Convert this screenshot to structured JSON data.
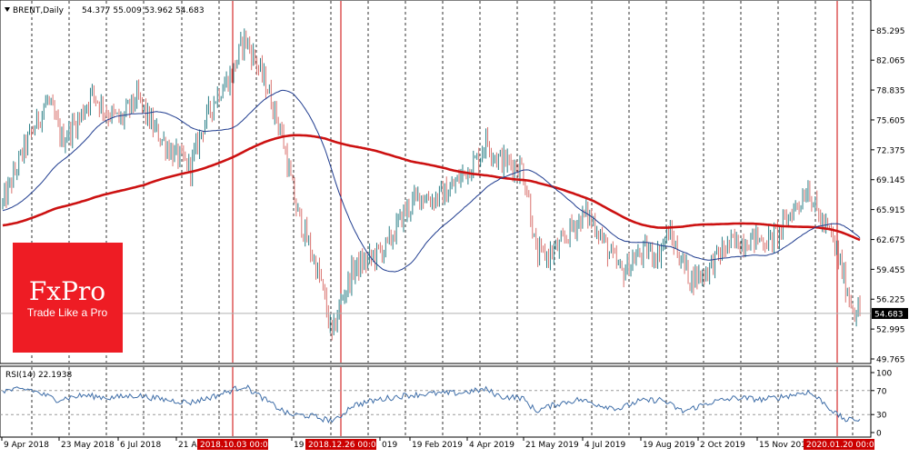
{
  "header": {
    "symbol_label": "BRENT,Daily",
    "ohlc": "54.377 55.009 53.962 54.683"
  },
  "logo": {
    "brand": "FxPro",
    "tagline": "Trade Like a Pro"
  },
  "rsi_label": "RSI(14) 22.1938",
  "colors": {
    "bull": "#2a7f86",
    "bear": "#d9736f",
    "ma_slow": "#cc1111",
    "ma_fast": "#1f3c8f",
    "marker": "#cc0000",
    "logo_bg": "#ee1c24",
    "rsi_line": "#3f6ea8",
    "current_bg": "#000000"
  },
  "chart_data": {
    "type": "candlestick",
    "symbol": "BRENT",
    "timeframe": "Daily",
    "ylim": [
      49.765,
      86.8
    ],
    "price_ticks": [
      "85.295",
      "82.065",
      "78.835",
      "75.605",
      "72.375",
      "69.145",
      "65.915",
      "62.675",
      "59.455",
      "56.225",
      "52.995",
      "49.765"
    ],
    "current_price": "54.683",
    "x_ticks": [
      "9 Apr 2018",
      "23 May 2018",
      "6 Jul 2018",
      "21 Au",
      "19",
      "019",
      "19 Feb 2019",
      "4 Apr 2019",
      "21 May 2019",
      "4 Jul 2019",
      "19 Aug 2019",
      "2 Oct 2019",
      "15 Nov 201"
    ],
    "vertical_markers": [
      "2018.10.03 00:00",
      "2018.12.26 00:00",
      "2020.01.20 00:00"
    ],
    "price_keypoints": [
      [
        0,
        66.5
      ],
      [
        12,
        72.5
      ],
      [
        25,
        77.8
      ],
      [
        33,
        73.5
      ],
      [
        42,
        75.5
      ],
      [
        50,
        78.5
      ],
      [
        58,
        76.5
      ],
      [
        66,
        75.5
      ],
      [
        75,
        78.0
      ],
      [
        85,
        74.5
      ],
      [
        95,
        72.0
      ],
      [
        105,
        70.5
      ],
      [
        112,
        75.0
      ],
      [
        120,
        78.5
      ],
      [
        128,
        80.5
      ],
      [
        135,
        84.5
      ],
      [
        140,
        82.5
      ],
      [
        148,
        79.0
      ],
      [
        156,
        74.0
      ],
      [
        164,
        66.0
      ],
      [
        172,
        61.5
      ],
      [
        178,
        58.0
      ],
      [
        184,
        52.0
      ],
      [
        188,
        55.5
      ],
      [
        196,
        59.5
      ],
      [
        205,
        60.5
      ],
      [
        215,
        62.0
      ],
      [
        224,
        65.5
      ],
      [
        233,
        67.5
      ],
      [
        240,
        67.0
      ],
      [
        250,
        68.0
      ],
      [
        258,
        70.0
      ],
      [
        266,
        71.5
      ],
      [
        270,
        73.5
      ],
      [
        276,
        71.5
      ],
      [
        282,
        71.0
      ],
      [
        290,
        70.5
      ],
      [
        294,
        67.0
      ],
      [
        298,
        61.0
      ],
      [
        305,
        61.0
      ],
      [
        312,
        62.0
      ],
      [
        318,
        64.0
      ],
      [
        326,
        65.5
      ],
      [
        332,
        64.0
      ],
      [
        338,
        61.5
      ],
      [
        346,
        59.0
      ],
      [
        352,
        60.5
      ],
      [
        360,
        61.5
      ],
      [
        366,
        61.0
      ],
      [
        372,
        63.5
      ],
      [
        378,
        61.0
      ],
      [
        384,
        58.5
      ],
      [
        392,
        59.0
      ],
      [
        398,
        60.5
      ],
      [
        405,
        62.0
      ],
      [
        412,
        62.5
      ],
      [
        420,
        62.8
      ],
      [
        428,
        62.5
      ],
      [
        434,
        63.5
      ],
      [
        440,
        65.5
      ],
      [
        446,
        67.0
      ],
      [
        450,
        68.5
      ],
      [
        454,
        66.0
      ],
      [
        458,
        64.5
      ],
      [
        463,
        63.0
      ],
      [
        468,
        60.0
      ],
      [
        472,
        57.0
      ],
      [
        476,
        55.0
      ]
    ],
    "rsi_ylim": [
      0,
      100
    ],
    "rsi_ticks": [
      "100",
      "70",
      "30",
      "0"
    ],
    "rsi_keypoints": [
      [
        0,
        70
      ],
      [
        15,
        72
      ],
      [
        30,
        55
      ],
      [
        45,
        62
      ],
      [
        60,
        58
      ],
      [
        75,
        62
      ],
      [
        90,
        55
      ],
      [
        105,
        50
      ],
      [
        120,
        62
      ],
      [
        135,
        78
      ],
      [
        140,
        68
      ],
      [
        150,
        48
      ],
      [
        160,
        30
      ],
      [
        172,
        28
      ],
      [
        180,
        22
      ],
      [
        186,
        20
      ],
      [
        195,
        45
      ],
      [
        210,
        55
      ],
      [
        225,
        62
      ],
      [
        240,
        65
      ],
      [
        255,
        66
      ],
      [
        270,
        72
      ],
      [
        278,
        60
      ],
      [
        290,
        58
      ],
      [
        298,
        36
      ],
      [
        310,
        48
      ],
      [
        322,
        55
      ],
      [
        335,
        45
      ],
      [
        345,
        40
      ],
      [
        355,
        52
      ],
      [
        368,
        55
      ],
      [
        380,
        35
      ],
      [
        395,
        50
      ],
      [
        410,
        58
      ],
      [
        425,
        55
      ],
      [
        440,
        62
      ],
      [
        450,
        68
      ],
      [
        458,
        52
      ],
      [
        466,
        30
      ],
      [
        472,
        20
      ],
      [
        476,
        22
      ]
    ]
  }
}
